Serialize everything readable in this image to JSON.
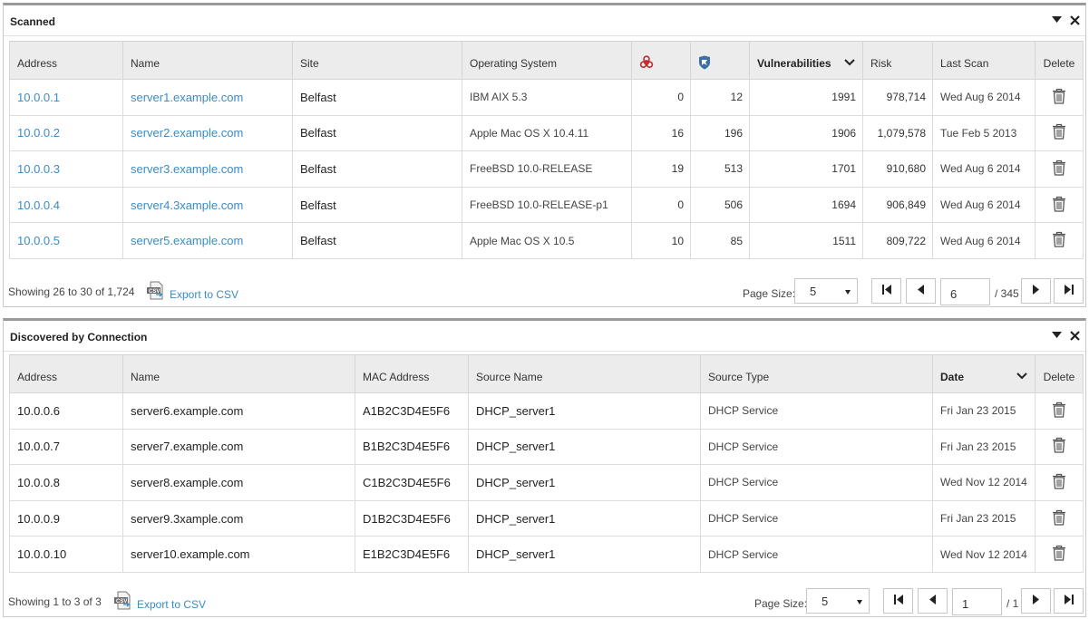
{
  "scanned": {
    "title": "Scanned",
    "columns": {
      "address": "Address",
      "name": "Name",
      "site": "Site",
      "os": "Operating System",
      "vulnerabilities": "Vulnerabilities",
      "risk": "Risk",
      "last_scan": "Last Scan",
      "delete": "Delete"
    },
    "rows": [
      {
        "address": "10.0.0.1",
        "name": "server1.example.com",
        "site": "Belfast",
        "os": "IBM AIX 5.3",
        "malware": "0",
        "exploits": "12",
        "vulnerabilities": "1991",
        "risk": "978,714",
        "last_scan": "Wed Aug 6 2014"
      },
      {
        "address": "10.0.0.2",
        "name": "server2.example.com",
        "site": "Belfast",
        "os": "Apple Mac OS X 10.4.11",
        "malware": "16",
        "exploits": "196",
        "vulnerabilities": "1906",
        "risk": "1,079,578",
        "last_scan": "Tue Feb 5 2013"
      },
      {
        "address": "10.0.0.3",
        "name": "server3.example.com",
        "site": "Belfast",
        "os": "FreeBSD 10.0-RELEASE",
        "malware": "19",
        "exploits": "513",
        "vulnerabilities": "1701",
        "risk": "910,680",
        "last_scan": "Wed Aug 6 2014"
      },
      {
        "address": "10.0.0.4",
        "name": "server4.3xample.com",
        "site": "Belfast",
        "os": "FreeBSD 10.0-RELEASE-p1",
        "malware": "0",
        "exploits": "506",
        "vulnerabilities": "1694",
        "risk": "906,849",
        "last_scan": "Wed Aug 6 2014"
      },
      {
        "address": "10.0.0.5",
        "name": "server5.example.com",
        "site": "Belfast",
        "os": "Apple Mac OS X 10.5",
        "malware": "10",
        "exploits": "85",
        "vulnerabilities": "1511",
        "risk": "809,722",
        "last_scan": "Wed Aug 6 2014"
      }
    ],
    "footer": {
      "showing": "Showing 26 to 30 of 1,724",
      "export": "Export to CSV",
      "page_size_label": "Page Size:",
      "page_size": "5",
      "page": "6",
      "total_pages": "/ 345"
    }
  },
  "discovered": {
    "title": "Discovered by Connection",
    "columns": {
      "address": "Address",
      "name": "Name",
      "mac": "MAC Address",
      "source_name": "Source Name",
      "source_type": "Source Type",
      "date": "Date",
      "delete": "Delete"
    },
    "rows": [
      {
        "address": "10.0.0.6",
        "name": "server6.example.com",
        "mac": "A1B2C3D4E5F6",
        "source_name": "DHCP_server1",
        "source_type": "DHCP Service",
        "date": "Fri Jan 23 2015"
      },
      {
        "address": "10.0.0.7",
        "name": "server7.example.com",
        "mac": "B1B2C3D4E5F6",
        "source_name": "DHCP_server1",
        "source_type": "DHCP Service",
        "date": "Fri Jan 23 2015"
      },
      {
        "address": "10.0.0.8",
        "name": "server8.example.com",
        "mac": "C1B2C3D4E5F6",
        "source_name": "DHCP_server1",
        "source_type": "DHCP Service",
        "date": "Wed Nov 12 2014"
      },
      {
        "address": "10.0.0.9",
        "name": "server9.3xample.com",
        "mac": "D1B2C3D4E5F6",
        "source_name": "DHCP_server1",
        "source_type": "DHCP Service",
        "date": "Fri Jan 23 2015"
      },
      {
        "address": "10.0.0.10",
        "name": "server10.example.com",
        "mac": "E1B2C3D4E5F6",
        "source_name": "DHCP_server1",
        "source_type": "DHCP Service",
        "date": "Wed Nov 12 2014"
      }
    ],
    "footer": {
      "showing": "Showing 1 to 3 of 3",
      "export": "Export to CSV",
      "page_size_label": "Page Size:",
      "page_size": "5",
      "page": "1",
      "total_pages": "/ 1"
    }
  },
  "icons": {
    "malware_column": "biohazard-icon",
    "exploits_column": "exploit-shield-icon",
    "delete": "trash-icon",
    "export": "csv-file-icon",
    "collapse": "collapse-triangle-icon",
    "close": "close-icon",
    "pager": [
      "first-page-icon",
      "prev-page-icon",
      "next-page-icon",
      "last-page-icon"
    ]
  },
  "colors": {
    "link": "#3a8cc4",
    "malware_icon": "#c0282d",
    "exploit_icon": "#3b6fa8",
    "header_bg": "#ececec"
  }
}
